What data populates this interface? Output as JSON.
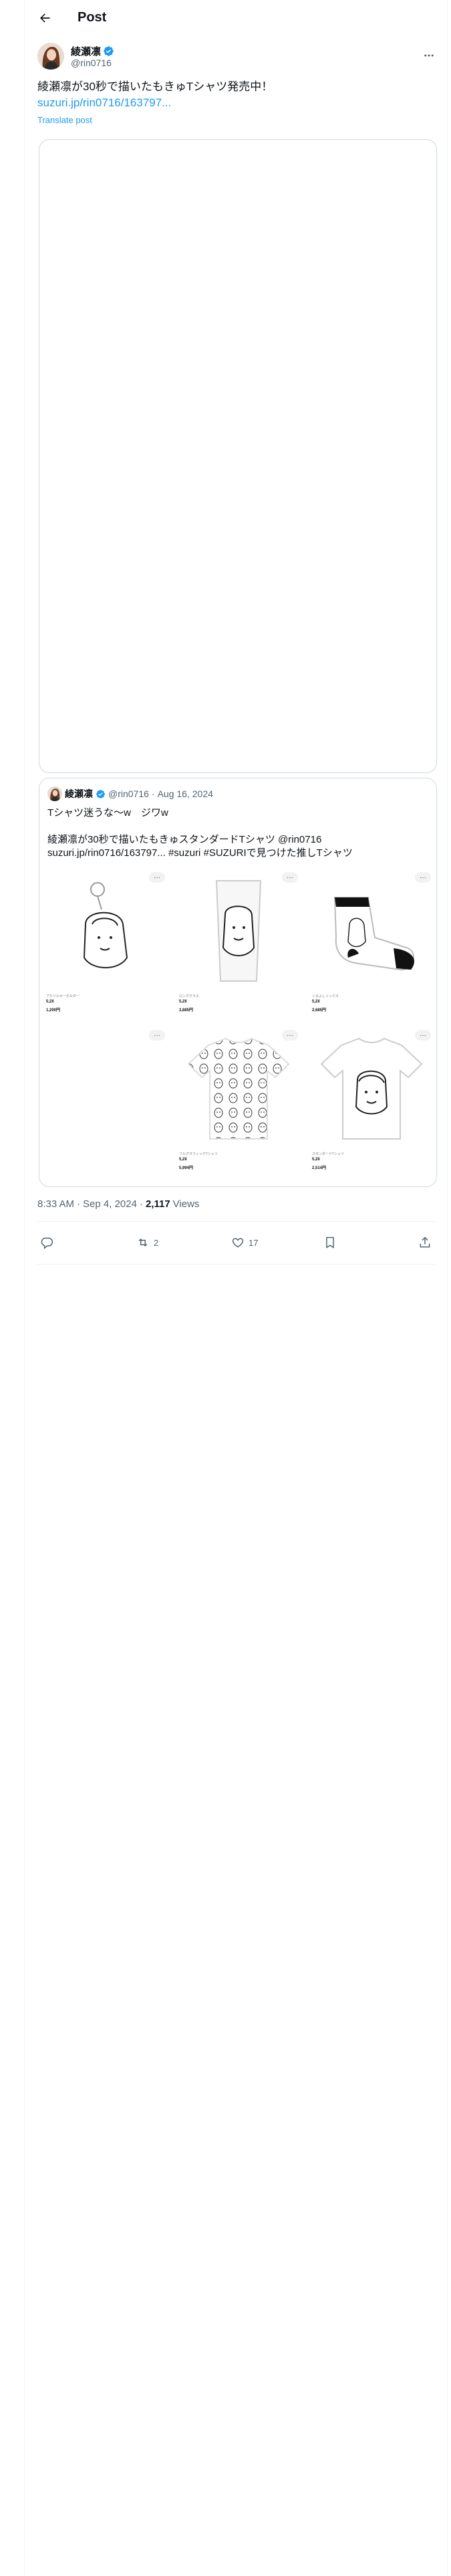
{
  "header": {
    "title": "Post",
    "back_icon": "arrow-left-icon"
  },
  "author": {
    "name": "綾瀬凛",
    "handle": "@rin0716",
    "verified": true,
    "more_icon": "more-horizontal-icon"
  },
  "post": {
    "text": "綾瀬凛が30秒で描いたもきゅTシャツ発売中！",
    "link": "suzuri.jp/rin0716/163797...",
    "translate_label": "Translate post"
  },
  "quote": {
    "name": "綾瀬凛",
    "handle": "@rin0716",
    "dot": "·",
    "date": "Aug 16, 2024",
    "text": "Tシャツ迷うな〜w　ジワw\n\n綾瀬凛が30秒で描いたもきゅスタンダードTシャツ @rin0716\nsuzuri.jp/rin0716/163797... #suzuri #SUZURIで見つけた推しTシャツ",
    "products": [
      {
        "category": "アクリルキーホルダー",
        "price": "5,2¥",
        "sub": "1,200円",
        "icon": "keychain-product-icon"
      },
      {
        "category": "ロンググラス",
        "price": "5,2¥",
        "sub": "3,885円",
        "icon": "glass-product-icon"
      },
      {
        "category": "くるぶしソックス",
        "price": "5,2¥",
        "sub": "2,685円",
        "icon": "sock-product-icon"
      },
      {
        "category": "",
        "price": "",
        "sub": "",
        "icon": ""
      },
      {
        "category": "フルグラフィックTシャツ",
        "price": "5,2¥",
        "sub": "5,994円",
        "icon": "pattern-tshirt-product-icon"
      },
      {
        "category": "スタンダードTシャツ",
        "price": "5,2¥",
        "sub": "2,514円",
        "icon": "tshirt-product-icon"
      }
    ],
    "menu_label": "···"
  },
  "meta": {
    "time": "8:33 AM",
    "dot": "·",
    "date": "Sep 4, 2024",
    "dot2": "·",
    "views_count": "2,117",
    "views_label": "Views"
  },
  "actions": {
    "reply_count": "",
    "repost_count": "2",
    "like_count": "17",
    "bookmark_icon": "bookmark-icon",
    "share_icon": "share-icon"
  },
  "colors": {
    "accent": "#1d9bf0",
    "text": "#0f1419",
    "muted": "#536471",
    "border": "#cfd9de"
  }
}
